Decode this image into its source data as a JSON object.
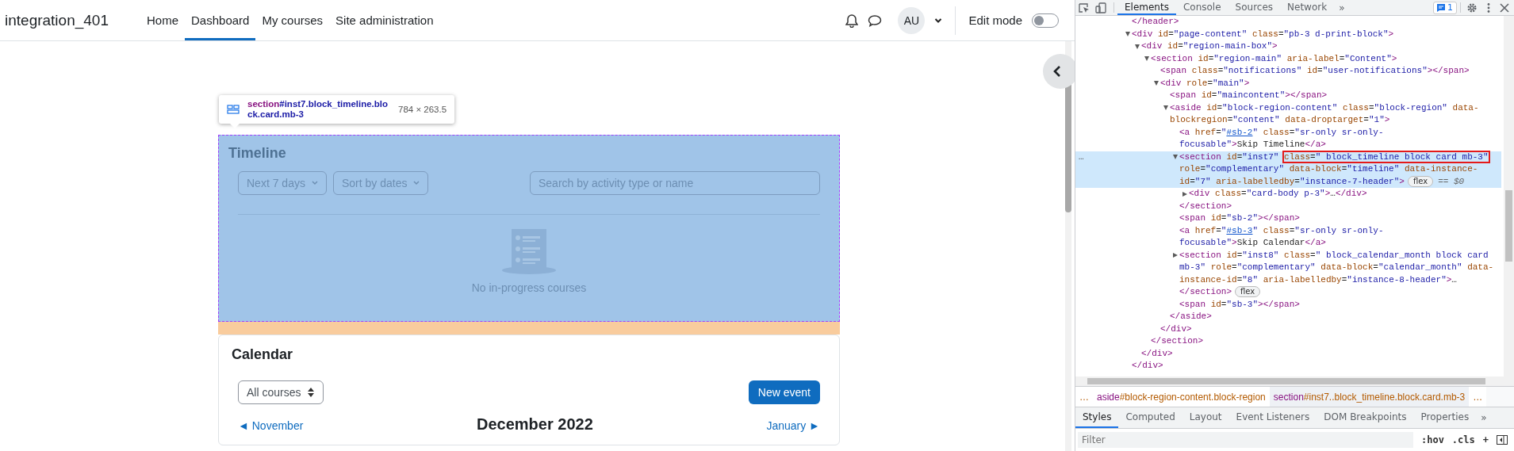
{
  "site_name": "integration_401",
  "nav": [
    {
      "label": "Home",
      "selected": false
    },
    {
      "label": "Dashboard",
      "selected": true
    },
    {
      "label": "My courses",
      "selected": false
    },
    {
      "label": "Site administration",
      "selected": false
    }
  ],
  "user": {
    "initials": "AU"
  },
  "edit_mode": {
    "label": "Edit mode",
    "on": false
  },
  "inspect_tooltip": {
    "selector": "section#inst7.block_timeline.block.card.mb-3",
    "size": "784 × 263.5"
  },
  "timeline": {
    "title": "Timeline",
    "highlighted": true,
    "filters": [
      "Next 7 days",
      "Sort by dates"
    ],
    "search": {
      "placeholder": "Search by activity type or name"
    },
    "empty_text": "No in-progress courses"
  },
  "calendar": {
    "title": "Calendar",
    "course_filter": "All courses",
    "new_event": "New event",
    "prev": "◄ November",
    "month": "December 2022",
    "next": "January ►"
  },
  "devtools": {
    "tabs": [
      {
        "label": "Elements",
        "selected": true
      },
      {
        "label": "Console",
        "selected": false
      },
      {
        "label": "Sources",
        "selected": false
      },
      {
        "label": "Network",
        "selected": false
      }
    ],
    "more_tabs": "»",
    "issues_count": "1",
    "dom": [
      {
        "text": "</header>"
      },
      {
        "text": "<div id=\"page-content\" class=\"pb-3 d-print-block\">",
        "expanded": true,
        "children": [
          {
            "text": "<div id=\"region-main-box\">",
            "expanded": true,
            "children": [
              {
                "text": "<section id=\"region-main\" aria-label=\"Content\">",
                "expanded": true,
                "children": [
                  {
                    "text": "<span class=\"notifications\" id=\"user-notifications\"></span>"
                  },
                  {
                    "text": "<div role=\"main\">",
                    "expanded": true,
                    "children": [
                      {
                        "text": "<span id=\"maincontent\"></span>"
                      },
                      {
                        "text": "<aside id=\"block-region-content\" class=\"block-region\" data-blockregion=\"content\" data-droptarget=\"1\">",
                        "expanded": true,
                        "children": [
                          {
                            "text": "<a href=\"#sb-2\" class=\"sr-only sr-only-focusable\">Skip Timeline</a>"
                          },
                          {
                            "text": "<section id=\"inst7\" ",
                            "boxed": "class=\" block_timeline block  card mb-3\"",
                            "text_after": " role=\"complementary\" data-block=\"timeline\" data-instance-id=\"7\" aria-labelledby=\"instance-7-header\">",
                            "badge": "flex",
                            "suffix": "== $0",
                            "options": "…",
                            "selected": true,
                            "expanded": true,
                            "children": [
                              {
                                "text": "<div class=\"card-body p-3\">…</div>",
                                "expanded": false
                              }
                            ]
                          },
                          {
                            "text": "</section>"
                          },
                          {
                            "text": "<span id=\"sb-2\"></span>"
                          },
                          {
                            "text": "<a href=\"#sb-3\" class=\"sr-only sr-only-focusable\">Skip Calendar</a>"
                          },
                          {
                            "text": "<section id=\"inst8\" class=\" block_calendar_month block  card mb-3\" role=\"complementary\" data-block=\"calendar_month\" data-instance-id=\"8\" aria-labelledby=\"instance-8-header\">…</section>",
                            "badge": "flex",
                            "expanded": false
                          },
                          {
                            "text": "<span id=\"sb-3\"></span>"
                          }
                        ]
                      },
                      {
                        "text": "</aside>"
                      }
                    ]
                  },
                  {
                    "text": "</div>"
                  }
                ]
              },
              {
                "text": "</section>"
              }
            ]
          },
          {
            "text": "</div>"
          }
        ]
      },
      {
        "text": "</div>"
      }
    ],
    "breadcrumbs": [
      {
        "label": "…",
        "selected": false
      },
      {
        "label": "aside#block-region-content.block-region",
        "selected": false
      },
      {
        "label": "section#inst7..block_timeline.block.card.mb-3",
        "selected": true
      },
      {
        "label": "…",
        "selected": false
      }
    ],
    "pane_tabs": [
      {
        "label": "Styles",
        "selected": true
      },
      {
        "label": "Computed",
        "selected": false
      },
      {
        "label": "Layout",
        "selected": false
      },
      {
        "label": "Event Listeners",
        "selected": false
      },
      {
        "label": "DOM Breakpoints",
        "selected": false
      },
      {
        "label": "Properties",
        "selected": false
      }
    ],
    "more_pane_tabs": "»",
    "filter": {
      "placeholder": "Filter"
    },
    "hov": ":hov",
    "cls": ".cls",
    "plus": "+"
  }
}
